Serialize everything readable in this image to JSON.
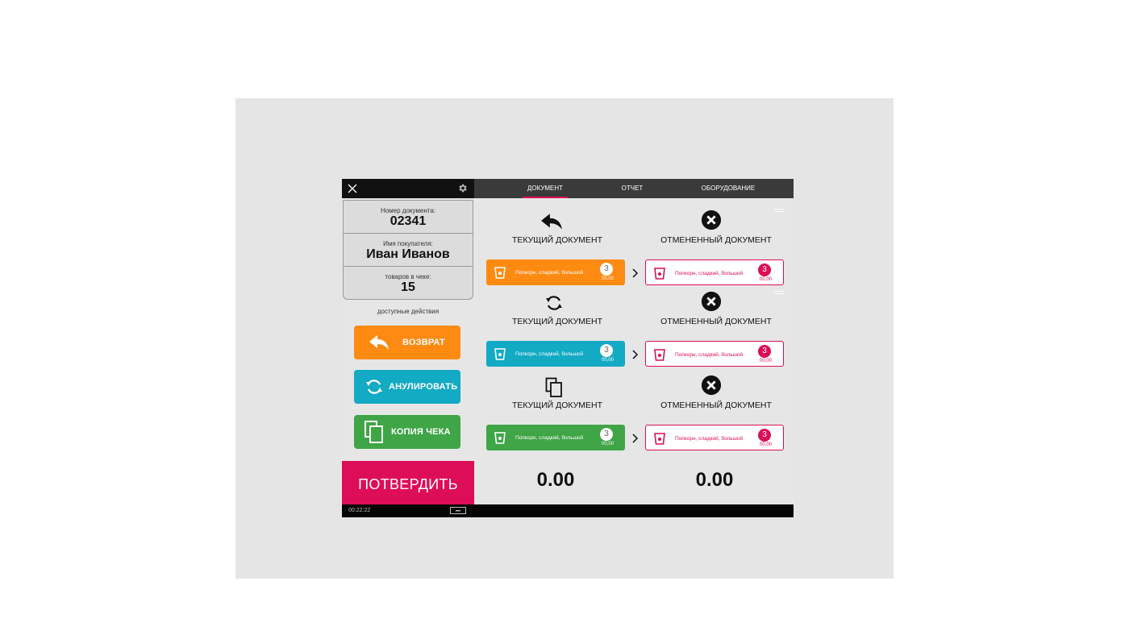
{
  "info": {
    "doc_number_label": "Номер документа:",
    "doc_number": "02341",
    "customer_label": "Имя покупателя:",
    "customer_name": "Иван Иванов",
    "items_label": "товаров в чеке:",
    "items_count": "15"
  },
  "actions": {
    "label": "доступные действия",
    "return_label": "ВОЗВРАТ",
    "cancel_label": "АНУЛИРОВАТЬ",
    "copy_label": "КОПИЯ ЧЕКА"
  },
  "confirm_label": "ПОТВЕРДИТЬ",
  "status": {
    "time": "00:22:22"
  },
  "tabs": {
    "document": "ДОКУМЕНТ",
    "report": "ОТЧЕТ",
    "equipment": "ОБОРУДОВАНИЕ"
  },
  "columns": {
    "current": "ТЕКУЩИЙ ДОКУМЕНТ",
    "cancelled": "ОТМЕНЕННЫЙ ДОКУМЕНТ"
  },
  "item": {
    "name": "Попкорн, сладкий, большой",
    "qty": "3",
    "price": "00,00"
  },
  "totals": {
    "current": "0.00",
    "cancelled": "0.00"
  },
  "colors": {
    "orange": "#ff8a12",
    "teal": "#13aac4",
    "green": "#3fa547",
    "accent": "#dd0d57"
  },
  "icons": [
    "close-icon",
    "gear-icon",
    "return-icon",
    "refresh-icon",
    "copy-icon",
    "cancel-x-icon",
    "cup-icon",
    "chevron-right-icon",
    "keyboard-icon"
  ]
}
